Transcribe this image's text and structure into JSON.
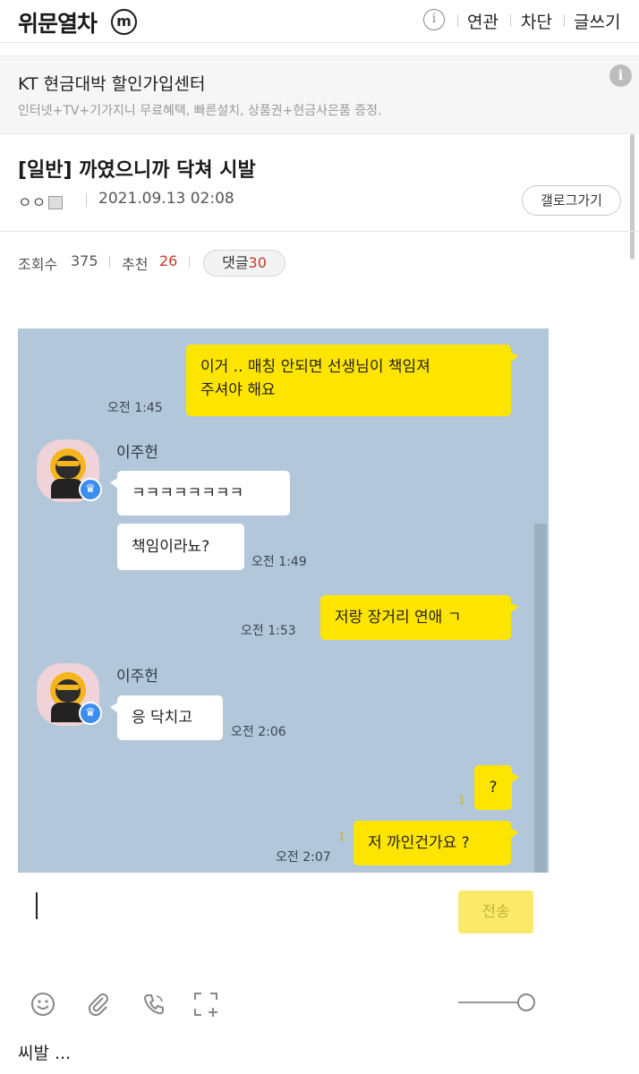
{
  "header": {
    "site_title": "위문열차",
    "m_badge": "m",
    "info_icon": "info-icon",
    "nav": [
      "연관",
      "차단",
      "글쓰기"
    ]
  },
  "ad": {
    "title": "KT 현금대박 할인가입센터",
    "subtitle": "인터넷+TV+기가지니 무료혜택, 빠른설치, 상품권+현금사은품 증정.",
    "info_icon": "info-icon"
  },
  "post": {
    "title": "[일반] 까였으니까 닥쳐 시발",
    "writer": "ㅇㅇ",
    "date": "2021.09.13 02:08",
    "gallery_button": "갤로그가기",
    "views_label": "조회수",
    "views": "375",
    "recommend_label": "추천",
    "recommend": "26",
    "comments_label": "댓글",
    "comments": "30",
    "body": "씨발 ..."
  },
  "chat": {
    "background": "#b2c7da",
    "my_bubble_color": "#fee500",
    "sender_name": "이주헌",
    "messages": [
      {
        "from": "me",
        "lines": [
          "이거 .. 매칭 안되면 선생님이 책임져",
          "주셔야 해요"
        ],
        "time": "오전 1:45"
      },
      {
        "from": "them",
        "text": "ㅋㅋㅋㅋㅋㅋㅋㅋ"
      },
      {
        "from": "them",
        "text": "책임이라뇨?",
        "time": "오전 1:49"
      },
      {
        "from": "me",
        "text": "저랑 장거리 연애 ㄱ",
        "time": "오전 1:53"
      },
      {
        "from": "them",
        "text": "응 닥치고",
        "time": "오전 2:06"
      },
      {
        "from": "me",
        "text": "?",
        "unread": "1"
      },
      {
        "from": "me",
        "text": "저 까인건가요 ?",
        "unread": "1",
        "time": "오전 2:07"
      }
    ],
    "send_button": "전송"
  },
  "toolbar": {
    "icons": [
      "emoticon-icon",
      "attach-icon",
      "call-icon",
      "capture-icon"
    ]
  }
}
